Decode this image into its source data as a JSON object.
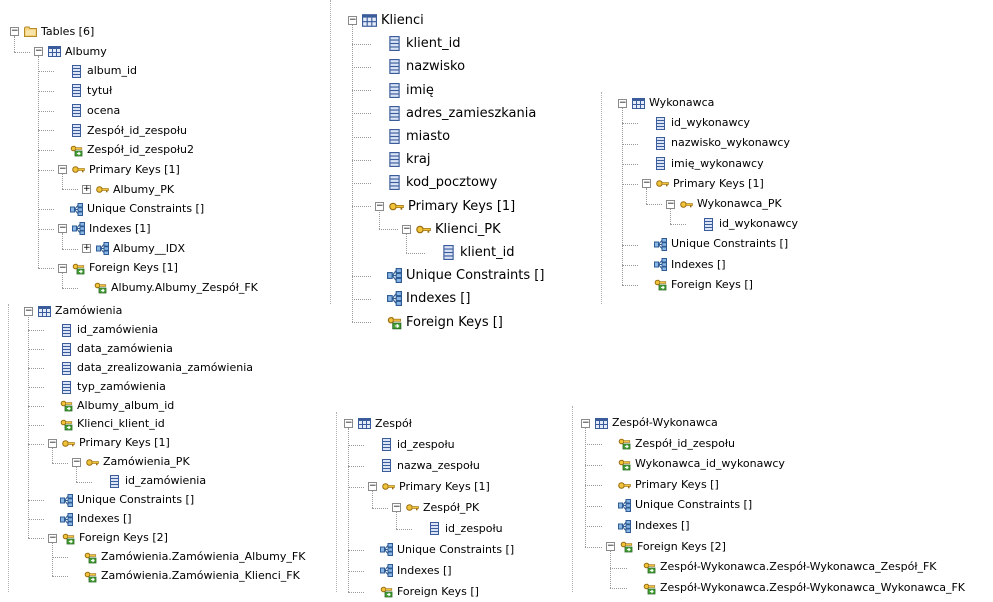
{
  "albumy_panel": {
    "tables_root": "Tables [6]",
    "table": "Albumy",
    "columns": [
      "album_id",
      "tytuł",
      "ocena",
      "Zespół_id_zespołu",
      "Zespół_id_zespołu2"
    ],
    "pk_group": "Primary Keys [1]",
    "pk": "Albumy_PK",
    "unique": "Unique Constraints []",
    "idx_group": "Indexes [1]",
    "idx": "Albumy__IDX",
    "fk_group": "Foreign Keys [1]",
    "fk": "Albumy.Albumy_Zespół_FK"
  },
  "klienci_panel": {
    "table": "Klienci",
    "columns": [
      "klient_id",
      "nazwisko",
      "imię",
      "adres_zamieszkania",
      "miasto",
      "kraj",
      "kod_pocztowy"
    ],
    "pk_group": "Primary Keys [1]",
    "pk": "Klienci_PK",
    "pk_col": "klient_id",
    "unique": "Unique Constraints []",
    "indexes": "Indexes []",
    "fk_group": "Foreign Keys []"
  },
  "wykonawca_panel": {
    "table": "Wykonawca",
    "columns": [
      "id_wykonawcy",
      "nazwisko_wykonawcy",
      "imię_wykonawcy"
    ],
    "pk_group": "Primary Keys [1]",
    "pk": "Wykonawca_PK",
    "pk_col": "id_wykonawcy",
    "unique": "Unique Constraints []",
    "indexes": "Indexes []",
    "fk_group": "Foreign Keys []"
  },
  "zamowienia_panel": {
    "table": "Zamówienia",
    "columns": [
      "id_zamówienia",
      "data_zamówienia",
      "data_zrealizowania_zamówienia",
      "typ_zamówienia"
    ],
    "fk_columns": [
      "Albumy_album_id",
      "Klienci_klient_id"
    ],
    "pk_group": "Primary Keys [1]",
    "pk": "Zamówienia_PK",
    "pk_col": "id_zamówienia",
    "unique": "Unique Constraints []",
    "indexes": "Indexes []",
    "fk_group": "Foreign Keys [2]",
    "fks": [
      "Zamówienia.Zamówienia_Albumy_FK",
      "Zamówienia.Zamówienia_Klienci_FK"
    ]
  },
  "zespol_panel": {
    "table": "Zespół",
    "columns": [
      "id_zespołu",
      "nazwa_zespołu"
    ],
    "pk_group": "Primary Keys [1]",
    "pk": "Zespół_PK",
    "pk_col": "id_zespołu",
    "unique": "Unique Constraints []",
    "indexes": "Indexes []",
    "fk_group": "Foreign Keys []"
  },
  "zw_panel": {
    "table": "Zespół-Wykonawca",
    "fk_columns": [
      "Zespół_id_zespołu",
      "Wykonawca_id_wykonawcy"
    ],
    "pk_group": "Primary Keys []",
    "unique": "Unique Constraints []",
    "indexes": "Indexes []",
    "fk_group": "Foreign Keys [2]",
    "fks": [
      "Zespół-Wykonawca.Zespół-Wykonawca_Zespół_FK",
      "Zespół-Wykonawca.Zespół-Wykonawca_Wykonawca_FK"
    ]
  }
}
